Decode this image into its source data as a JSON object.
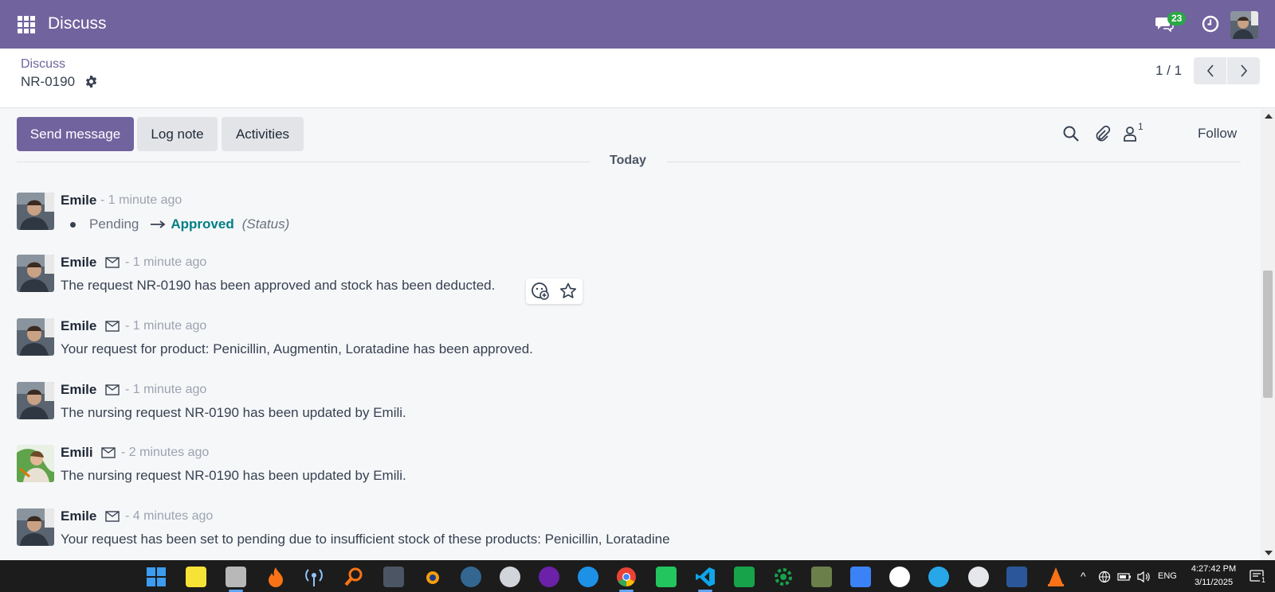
{
  "navbar": {
    "app_title": "Discuss",
    "chat_badge": "23",
    "color": "#71639e"
  },
  "control_panel": {
    "breadcrumb": "Discuss",
    "record_name": "NR-0190",
    "pager": "1 / 1"
  },
  "chatter": {
    "send_message": "Send message",
    "log_note": "Log note",
    "activities": "Activities",
    "follower_count": "1",
    "follow": "Follow",
    "date_separator": "Today",
    "messages": [
      {
        "author": "Emile",
        "time": "- 1 minute ago",
        "tracking": {
          "old": "Pending",
          "new": "Approved",
          "field": "(Status)"
        },
        "avatar": "emile"
      },
      {
        "author": "Emile",
        "time": "- 1 minute ago",
        "body": "The request NR-0190 has been approved and stock has been deducted.",
        "avatar": "emile"
      },
      {
        "author": "Emile",
        "time": "- 1 minute ago",
        "body": "Your request for product: Penicillin, Augmentin, Loratadine has been approved.",
        "avatar": "emile"
      },
      {
        "author": "Emile",
        "time": "- 1 minute ago",
        "body": "The nursing request NR-0190 has been updated by Emili.",
        "avatar": "emile"
      },
      {
        "author": "Emili",
        "time": "- 2 minutes ago",
        "body": "The nursing request NR-0190 has been updated by Emili.",
        "avatar": "emili"
      },
      {
        "author": "Emile",
        "time": "- 4 minutes ago",
        "body": "Your request has been set to pending due to insufficient stock of these products: Penicillin, Loratadine",
        "avatar": "emile"
      }
    ]
  },
  "taskbar": {
    "language": "ENG",
    "time": "4:27:42 PM",
    "date": "3/11/2025",
    "notification_count": "1"
  }
}
